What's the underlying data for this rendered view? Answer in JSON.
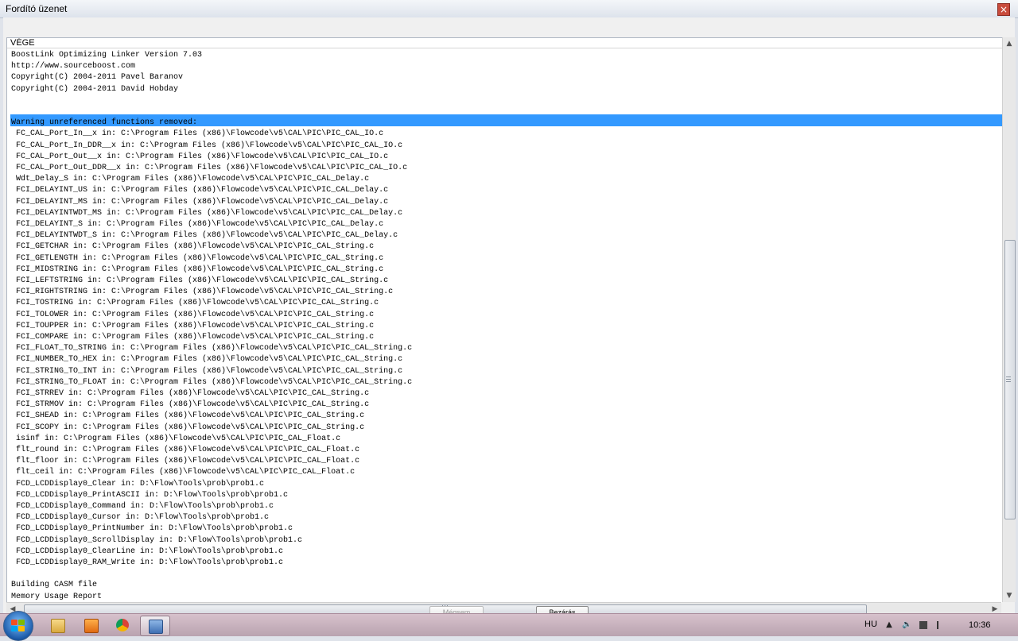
{
  "window": {
    "title": "Fordító üzenet",
    "close_glyph": "×"
  },
  "output": {
    "header": "VÉGE",
    "lines": [
      "BoostLink Optimizing Linker Version 7.03",
      "http://www.sourceboost.com",
      "Copyright(C) 2004-2011 Pavel Baranov",
      "Copyright(C) 2004-2011 David Hobday",
      "",
      "",
      "Warning unreferenced functions removed:",
      " FC_CAL_Port_In__x in: C:\\Program Files (x86)\\Flowcode\\v5\\CAL\\PIC\\PIC_CAL_IO.c",
      " FC_CAL_Port_In_DDR__x in: C:\\Program Files (x86)\\Flowcode\\v5\\CAL\\PIC\\PIC_CAL_IO.c",
      " FC_CAL_Port_Out__x in: C:\\Program Files (x86)\\Flowcode\\v5\\CAL\\PIC\\PIC_CAL_IO.c",
      " FC_CAL_Port_Out_DDR__x in: C:\\Program Files (x86)\\Flowcode\\v5\\CAL\\PIC\\PIC_CAL_IO.c",
      " Wdt_Delay_S in: C:\\Program Files (x86)\\Flowcode\\v5\\CAL\\PIC\\PIC_CAL_Delay.c",
      " FCI_DELAYINT_US in: C:\\Program Files (x86)\\Flowcode\\v5\\CAL\\PIC\\PIC_CAL_Delay.c",
      " FCI_DELAYINT_MS in: C:\\Program Files (x86)\\Flowcode\\v5\\CAL\\PIC\\PIC_CAL_Delay.c",
      " FCI_DELAYINTWDT_MS in: C:\\Program Files (x86)\\Flowcode\\v5\\CAL\\PIC\\PIC_CAL_Delay.c",
      " FCI_DELAYINT_S in: C:\\Program Files (x86)\\Flowcode\\v5\\CAL\\PIC\\PIC_CAL_Delay.c",
      " FCI_DELAYINTWDT_S in: C:\\Program Files (x86)\\Flowcode\\v5\\CAL\\PIC\\PIC_CAL_Delay.c",
      " FCI_GETCHAR in: C:\\Program Files (x86)\\Flowcode\\v5\\CAL\\PIC\\PIC_CAL_String.c",
      " FCI_GETLENGTH in: C:\\Program Files (x86)\\Flowcode\\v5\\CAL\\PIC\\PIC_CAL_String.c",
      " FCI_MIDSTRING in: C:\\Program Files (x86)\\Flowcode\\v5\\CAL\\PIC\\PIC_CAL_String.c",
      " FCI_LEFTSTRING in: C:\\Program Files (x86)\\Flowcode\\v5\\CAL\\PIC\\PIC_CAL_String.c",
      " FCI_RIGHTSTRING in: C:\\Program Files (x86)\\Flowcode\\v5\\CAL\\PIC\\PIC_CAL_String.c",
      " FCI_TOSTRING in: C:\\Program Files (x86)\\Flowcode\\v5\\CAL\\PIC\\PIC_CAL_String.c",
      " FCI_TOLOWER in: C:\\Program Files (x86)\\Flowcode\\v5\\CAL\\PIC\\PIC_CAL_String.c",
      " FCI_TOUPPER in: C:\\Program Files (x86)\\Flowcode\\v5\\CAL\\PIC\\PIC_CAL_String.c",
      " FCI_COMPARE in: C:\\Program Files (x86)\\Flowcode\\v5\\CAL\\PIC\\PIC_CAL_String.c",
      " FCI_FLOAT_TO_STRING in: C:\\Program Files (x86)\\Flowcode\\v5\\CAL\\PIC\\PIC_CAL_String.c",
      " FCI_NUMBER_TO_HEX in: C:\\Program Files (x86)\\Flowcode\\v5\\CAL\\PIC\\PIC_CAL_String.c",
      " FCI_STRING_TO_INT in: C:\\Program Files (x86)\\Flowcode\\v5\\CAL\\PIC\\PIC_CAL_String.c",
      " FCI_STRING_TO_FLOAT in: C:\\Program Files (x86)\\Flowcode\\v5\\CAL\\PIC\\PIC_CAL_String.c",
      " FCI_STRREV in: C:\\Program Files (x86)\\Flowcode\\v5\\CAL\\PIC\\PIC_CAL_String.c",
      " FCI_STRMOV in: C:\\Program Files (x86)\\Flowcode\\v5\\CAL\\PIC\\PIC_CAL_String.c",
      " FCI_SHEAD in: C:\\Program Files (x86)\\Flowcode\\v5\\CAL\\PIC\\PIC_CAL_String.c",
      " FCI_SCOPY in: C:\\Program Files (x86)\\Flowcode\\v5\\CAL\\PIC\\PIC_CAL_String.c",
      " isinf in: C:\\Program Files (x86)\\Flowcode\\v5\\CAL\\PIC\\PIC_CAL_Float.c",
      " flt_round in: C:\\Program Files (x86)\\Flowcode\\v5\\CAL\\PIC\\PIC_CAL_Float.c",
      " flt_floor in: C:\\Program Files (x86)\\Flowcode\\v5\\CAL\\PIC\\PIC_CAL_Float.c",
      " flt_ceil in: C:\\Program Files (x86)\\Flowcode\\v5\\CAL\\PIC\\PIC_CAL_Float.c",
      " FCD_LCDDisplay0_Clear in: D:\\Flow\\Tools\\prob\\prob1.c",
      " FCD_LCDDisplay0_PrintASCII in: D:\\Flow\\Tools\\prob\\prob1.c",
      " FCD_LCDDisplay0_Command in: D:\\Flow\\Tools\\prob\\prob1.c",
      " FCD_LCDDisplay0_Cursor in: D:\\Flow\\Tools\\prob\\prob1.c",
      " FCD_LCDDisplay0_PrintNumber in: D:\\Flow\\Tools\\prob\\prob1.c",
      " FCD_LCDDisplay0_ScrollDisplay in: D:\\Flow\\Tools\\prob\\prob1.c",
      " FCD_LCDDisplay0_ClearLine in: D:\\Flow\\Tools\\prob\\prob1.c",
      " FCD_LCDDisplay0_RAM_Write in: D:\\Flow\\Tools\\prob\\prob1.c",
      "",
      "Building CASM file",
      "Memory Usage Report"
    ]
  },
  "buttons": {
    "left_label": "Mégsem",
    "right_label": "Bezárás"
  },
  "taskbar": {
    "language": "HU",
    "clock": "10:36",
    "tray_up_glyph": "▲",
    "speaker_glyph": "🔈"
  },
  "colors": {
    "highlight": "#3399ff"
  }
}
